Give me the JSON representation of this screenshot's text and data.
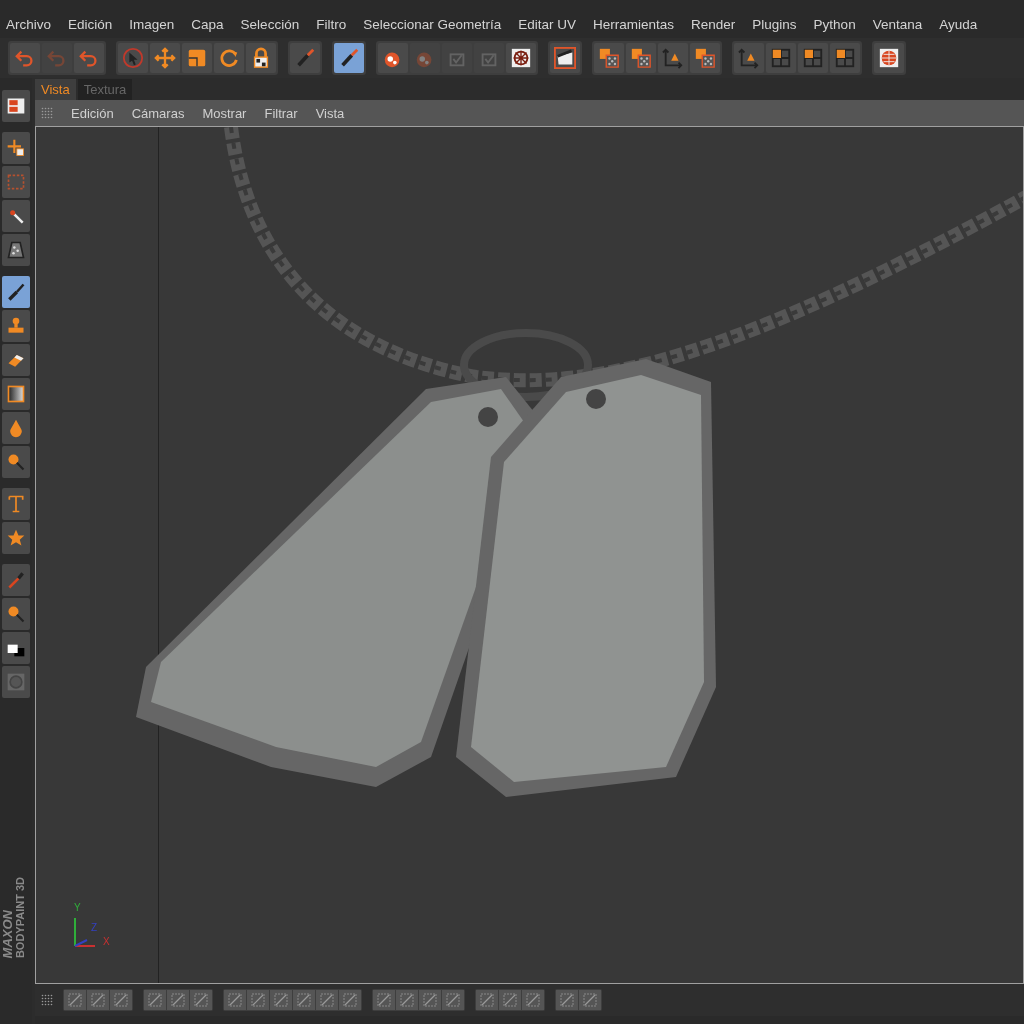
{
  "menu_bar": {
    "items": [
      "Archivo",
      "Edición",
      "Imagen",
      "Capa",
      "Selección",
      "Filtro",
      "Seleccionar Geometría",
      "Editar UV",
      "Herramientas",
      "Render",
      "Plugins",
      "Python",
      "Ventana",
      "Ayuda"
    ]
  },
  "toolbar": {
    "groups": [
      [
        {
          "selected": false,
          "disabled": false
        },
        {
          "selected": false,
          "disabled": true
        },
        {
          "selected": false,
          "disabled": false
        }
      ],
      [
        {
          "selected": false,
          "disabled": false
        },
        {
          "selected": false,
          "disabled": false
        },
        {
          "selected": false,
          "disabled": false
        },
        {
          "selected": false,
          "disabled": false
        },
        {
          "selected": false,
          "disabled": false
        }
      ],
      [
        {
          "selected": false,
          "disabled": false
        }
      ],
      [
        {
          "selected": true,
          "disabled": false
        }
      ],
      [
        {
          "selected": false,
          "disabled": false
        },
        {
          "selected": false,
          "disabled": true
        },
        {
          "selected": false,
          "disabled": true
        },
        {
          "selected": false,
          "disabled": true
        },
        {
          "selected": false,
          "disabled": false
        }
      ],
      [
        {
          "selected": false,
          "disabled": false
        }
      ],
      [
        {
          "selected": false,
          "disabled": false
        },
        {
          "selected": false,
          "disabled": false
        },
        {
          "selected": false,
          "disabled": false
        },
        {
          "selected": false,
          "disabled": false
        }
      ],
      [
        {
          "selected": false,
          "disabled": false
        },
        {
          "selected": false,
          "disabled": false
        },
        {
          "selected": false,
          "disabled": false
        },
        {
          "selected": false,
          "disabled": false
        }
      ],
      [
        {
          "selected": false,
          "disabled": false
        }
      ]
    ]
  },
  "tools": {
    "groups": [
      [
        {
          "selected": false
        }
      ],
      [
        {
          "selected": false
        },
        {
          "selected": false
        },
        {
          "selected": false
        },
        {
          "selected": false
        }
      ],
      [
        {
          "selected": true
        },
        {
          "selected": false
        },
        {
          "selected": false
        },
        {
          "selected": false
        },
        {
          "selected": false
        },
        {
          "selected": false
        }
      ],
      [
        {
          "selected": false
        },
        {
          "selected": false
        }
      ],
      [
        {
          "selected": false
        },
        {
          "selected": false
        },
        {
          "selected": false
        },
        {
          "selected": false
        }
      ]
    ]
  },
  "logo": {
    "line_1": "MAXON",
    "line_2": "BODYPAINT 3D"
  },
  "tabs": [
    {
      "label": "Vista",
      "selected": true
    },
    {
      "label": "Textura",
      "selected": false
    }
  ],
  "view_menu": {
    "items": [
      "Edición",
      "Cámaras",
      "Mostrar",
      "Filtrar",
      "Vista"
    ]
  },
  "viewport": {
    "axis_labels": [
      "Y",
      "Z",
      "X"
    ]
  }
}
